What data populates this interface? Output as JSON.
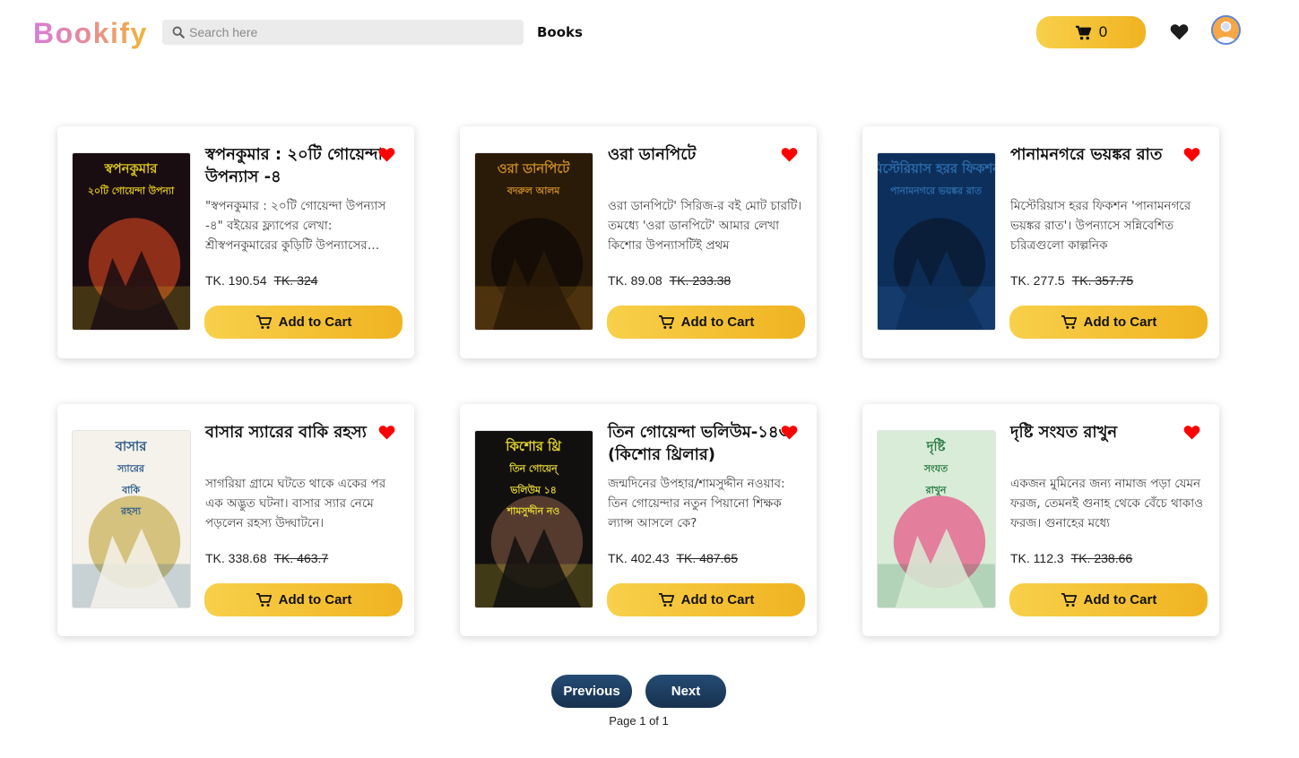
{
  "header": {
    "logo": "Bookify",
    "search_placeholder": "Search here",
    "nav_books": "Books",
    "cart_count": "0"
  },
  "colors": {
    "accent_yellow": "#f5c02f",
    "favorite_red": "#ff0000",
    "pagination_navy": "#1f3f62"
  },
  "icons": {
    "search": "search-icon",
    "cart": "shopping-cart-icon",
    "wishlist": "heart-icon",
    "profile": "user-avatar",
    "add_to_cart": "cart-outline-icon"
  },
  "books": [
    {
      "title": "স্বপনকুমার : ২০টি গোয়েন্দা উপন্যাস -৪",
      "description": "\"স্বপনকুমার : ২০টি গোয়েন্দা উপন্যাস -৪\" বইয়ের ফ্ল্যাপের লেখা: শ্রীস্বপনকুমারের কুড়িটি উপন্যাসের সংকলন",
      "price": "TK. 190.54",
      "old_price": "TK. 324",
      "button": "Add to Cart",
      "cover_text": [
        "স্বপনকুমার",
        "২০টি গোয়েন্দা উপন্যা"
      ],
      "cover_palette": [
        "#1a0d12",
        "#d8c21b",
        "#b53b1e"
      ]
    },
    {
      "title": "ওরা ডানপিটে",
      "description": "ওরা ডানপিটে' সিরিজ-র বই মোট চারটি। তমধ্যে 'ওরা ডানপিটে' আমার লেখা কিশোর উপন্যাসটিই প্রথম",
      "price": "TK. 89.08",
      "old_price": "TK. 233.38",
      "button": "Add to Cart",
      "cover_text": [
        "ওরা ডানপিটে",
        "বদরুল আলম"
      ],
      "cover_palette": [
        "#2a1a08",
        "#c78a22",
        "#0f0a05"
      ]
    },
    {
      "title": "পানামনগরে ভয়ঙ্কর রাত",
      "description": "মিস্টেরিয়াস হরর ফিকশন 'পানামনগরে ভয়ঙ্কর রাত'। উপন্যাসে সন্নিবেশিত চরিত্রগুলো কাল্পনিক",
      "price": "TK. 277.5",
      "old_price": "TK. 357.75",
      "button": "Add to Cart",
      "cover_text": [
        "মিস্টেরিয়াস হরর ফিকশন",
        "পানামনগরে ভয়ঙ্কর রাত"
      ],
      "cover_palette": [
        "#0d2f5c",
        "#2c6aa8",
        "#0a1a2e"
      ]
    },
    {
      "title": "বাসার স্যারের বাকি রহস্য",
      "description": "সাগরিয়া গ্রামে ঘটতে থাকে একের পর এক অদ্ভুত ঘটনা। বাসার স্যার নেমে পড়লেন রহস্য উদ্ঘাটনে।",
      "price": "TK. 338.68",
      "old_price": "TK. 463.7",
      "button": "Add to Cart",
      "cover_text": [
        "বাসার",
        "স্যারের",
        "বাকি",
        "রহস্য"
      ],
      "cover_palette": [
        "#f4f2ea",
        "#2f5d8a",
        "#c9b25a"
      ]
    },
    {
      "title": "তিন গোয়েন্দা ভলিউম-১৪৩ (কিশোর থ্রিলার)",
      "description": "জন্মদিনের উপহার/শামসুদ্দীন নওয়াব: তিন গোয়েন্দার নতুন পিয়ানো শিক্ষক ল্যান্স আসলে কে?",
      "price": "TK. 402.43",
      "old_price": "TK. 487.65",
      "button": "Add to Cart",
      "cover_text": [
        "কিশোর থ্রি",
        "তিন গোয়েন্",
        "ভলিউম ১৪",
        "শামসুদ্দীন নও"
      ],
      "cover_palette": [
        "#12100f",
        "#e2d332",
        "#6b4a3a"
      ]
    },
    {
      "title": "দৃষ্টি সংযত রাখুন",
      "description": "একজন মুমিনের জন্য নামাজ পড়া যেমন ফরজ, তেমনই গুনাহ থেকে বেঁচে থাকাও ফরজ। গুনাহের মধ্যে",
      "price": "TK. 112.3",
      "old_price": "TK. 238.66",
      "button": "Add to Cart",
      "cover_text": [
        "দৃষ্টি",
        "সংযত",
        "রাখুন"
      ],
      "cover_palette": [
        "#d9ecd7",
        "#2a7c48",
        "#e55a8a"
      ]
    }
  ],
  "pagination": {
    "previous": "Previous",
    "next": "Next",
    "page_info": "Page 1 of 1"
  }
}
